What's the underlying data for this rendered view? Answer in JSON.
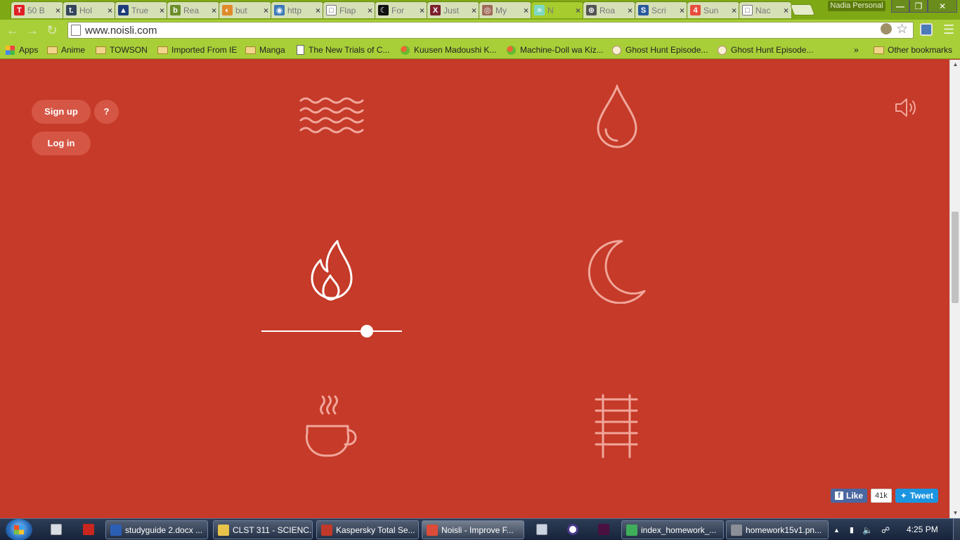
{
  "browser": {
    "tabs": [
      {
        "title": "50 B",
        "favicon": "T",
        "favicon_color": "#e01f25"
      },
      {
        "title": "Hol",
        "favicon": "t.",
        "favicon_color": "#35465c"
      },
      {
        "title": "True",
        "favicon": "▲",
        "favicon_color": "#1f3d7a"
      },
      {
        "title": "Rea",
        "favicon": "b",
        "favicon_color": "#6d8e2a"
      },
      {
        "title": "but",
        "favicon": "◐",
        "favicon_color": "#e08a2a"
      },
      {
        "title": "http",
        "favicon": "◉",
        "favicon_color": "#3d79b8"
      },
      {
        "title": "Flap",
        "favicon": "□",
        "favicon_color": "#ffffff"
      },
      {
        "title": "For",
        "favicon": "☾",
        "favicon_color": "#111111"
      },
      {
        "title": "Just",
        "favicon": "X",
        "favicon_color": "#7a1f2e"
      },
      {
        "title": "My",
        "favicon": "◎",
        "favicon_color": "#a06a5a"
      },
      {
        "title": "N",
        "favicon": "≈",
        "favicon_color": "#7fd9c2"
      },
      {
        "title": "Roa",
        "favicon": "⊛",
        "favicon_color": "#555555"
      },
      {
        "title": "Scri",
        "favicon": "S",
        "favicon_color": "#2b5a9c"
      },
      {
        "title": "Sun",
        "favicon": "4",
        "favicon_color": "#e84c3d"
      },
      {
        "title": "Nac",
        "favicon": "□",
        "favicon_color": "#ffffff"
      }
    ],
    "profile_name": "Nadia Personal",
    "url": "www.noisli.com",
    "window_controls": {
      "minimize": "—",
      "maximize": "❐",
      "close": "✕"
    },
    "bookmarks": [
      {
        "label": "Apps",
        "icon": "apps-icon"
      },
      {
        "label": "Anime",
        "icon": "folder-icon"
      },
      {
        "label": "TOWSON",
        "icon": "folder-icon"
      },
      {
        "label": "Imported From IE",
        "icon": "folder-icon"
      },
      {
        "label": "Manga",
        "icon": "folder-icon"
      },
      {
        "label": "The New Trials of C...",
        "icon": "page-icon"
      },
      {
        "label": "Kuusen Madoushi K...",
        "icon": "crunchyroll-icon"
      },
      {
        "label": "Machine-Doll wa Kiz...",
        "icon": "crunchyroll-icon"
      },
      {
        "label": "Ghost Hunt Episode...",
        "icon": "compass-icon"
      },
      {
        "label": "Ghost Hunt Episode...",
        "icon": "compass-icon"
      }
    ],
    "bookmarks_overflow": "»",
    "other_bookmarks": "Other bookmarks"
  },
  "page": {
    "signup_label": "Sign up",
    "help_label": "?",
    "login_label": "Log in",
    "sounds": [
      {
        "name": "water-icon",
        "active": false
      },
      {
        "name": "rain-icon",
        "active": false
      },
      {
        "name": "fire-icon",
        "active": true,
        "volume": 0.75
      },
      {
        "name": "moon-icon",
        "active": false
      },
      {
        "name": "coffee-icon",
        "active": false
      },
      {
        "name": "train-tracks-icon",
        "active": false
      }
    ],
    "like_label": "Like",
    "like_count": "41k",
    "tweet_label": "Tweet",
    "accent_color": "#c53a28"
  },
  "taskbar": {
    "tasks": [
      {
        "label": "studyguide 2.docx ...",
        "icon_color": "#2b5fb4"
      },
      {
        "label": "CLST 311 - SCIENC...",
        "icon_color": "#e8c34a"
      },
      {
        "label": "Kaspersky Total Se...",
        "icon_color": "#c0392b"
      },
      {
        "label": "Noisli - Improve F...",
        "icon_color": "#dd4b39",
        "active": true
      },
      {
        "label": "index_homework_...",
        "icon_color": "#3fae5a"
      },
      {
        "label": "homework15v1.pn...",
        "icon_color": "#8a8f98"
      }
    ],
    "clock": "4:25 PM"
  }
}
